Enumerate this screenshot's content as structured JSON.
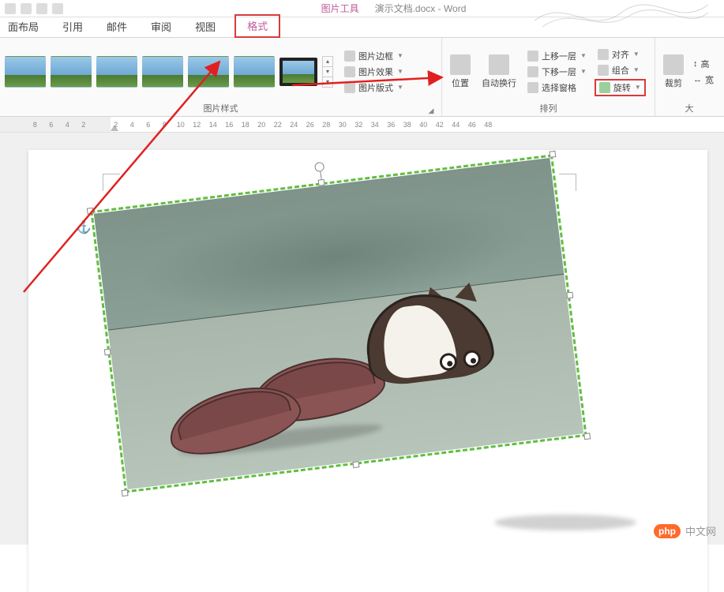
{
  "title": {
    "contextual_tab": "图片工具",
    "document": "演示文档.docx - Word"
  },
  "tabs": {
    "layout": "面布局",
    "references": "引用",
    "mailings": "邮件",
    "review": "审阅",
    "view": "视图",
    "format": "格式"
  },
  "ribbon": {
    "styles_group_label": "图片样式",
    "arrange_group_label": "排列",
    "border": "图片边框",
    "effects": "图片效果",
    "layout": "图片版式",
    "position": "位置",
    "wrap": "自动换行",
    "bring_forward": "上移一层",
    "send_backward": "下移一层",
    "selection_pane": "选择窗格",
    "align": "对齐",
    "group": "组合",
    "rotate": "旋转",
    "crop": "裁剪",
    "height": "高",
    "width": "宽"
  },
  "ruler": [
    "8",
    "6",
    "4",
    "2",
    "",
    "2",
    "4",
    "6",
    "8",
    "10",
    "12",
    "14",
    "16",
    "18",
    "20",
    "22",
    "24",
    "26",
    "28",
    "30",
    "32",
    "34",
    "36",
    "38",
    "40",
    "42",
    "44",
    "46",
    "48"
  ],
  "watermark": {
    "badge": "php",
    "text": "中文网"
  }
}
